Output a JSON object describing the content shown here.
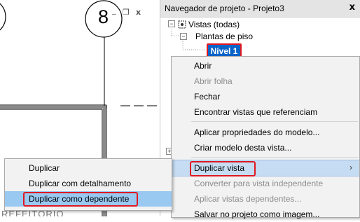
{
  "drawing": {
    "level_label": "8",
    "partial_room_text": "REFEITÓRIO",
    "window_controls": {
      "restore": "❐",
      "close": "x"
    }
  },
  "browser": {
    "title": "Navegador de projeto - Projeto3",
    "close": "x",
    "tree": {
      "root": "Vistas (todas)",
      "child": "Plantas de piso",
      "selected": "Nível 1"
    }
  },
  "context_menu": {
    "items": [
      {
        "label": "Abrir",
        "enabled": true
      },
      {
        "label": "Abrir folha",
        "enabled": false
      },
      {
        "label": "Fechar",
        "enabled": true
      },
      {
        "label": "Encontrar vistas que referenciam",
        "enabled": true
      },
      {
        "label": "Aplicar propriedades do modelo...",
        "enabled": true
      },
      {
        "label": "Criar modelo desta vista...",
        "enabled": true
      },
      {
        "label": "Duplicar vista",
        "enabled": true,
        "submenu_arrow": "›"
      },
      {
        "label": "Converter para vista independente",
        "enabled": false
      },
      {
        "label": "Aplicar vistas dependentes...",
        "enabled": false
      },
      {
        "label": "Salvar no projeto como imagem...",
        "enabled": true
      }
    ]
  },
  "submenu": {
    "items": [
      {
        "label": "Duplicar"
      },
      {
        "label": "Duplicar com detalhamento"
      },
      {
        "label": "Duplicar como dependente"
      }
    ]
  }
}
